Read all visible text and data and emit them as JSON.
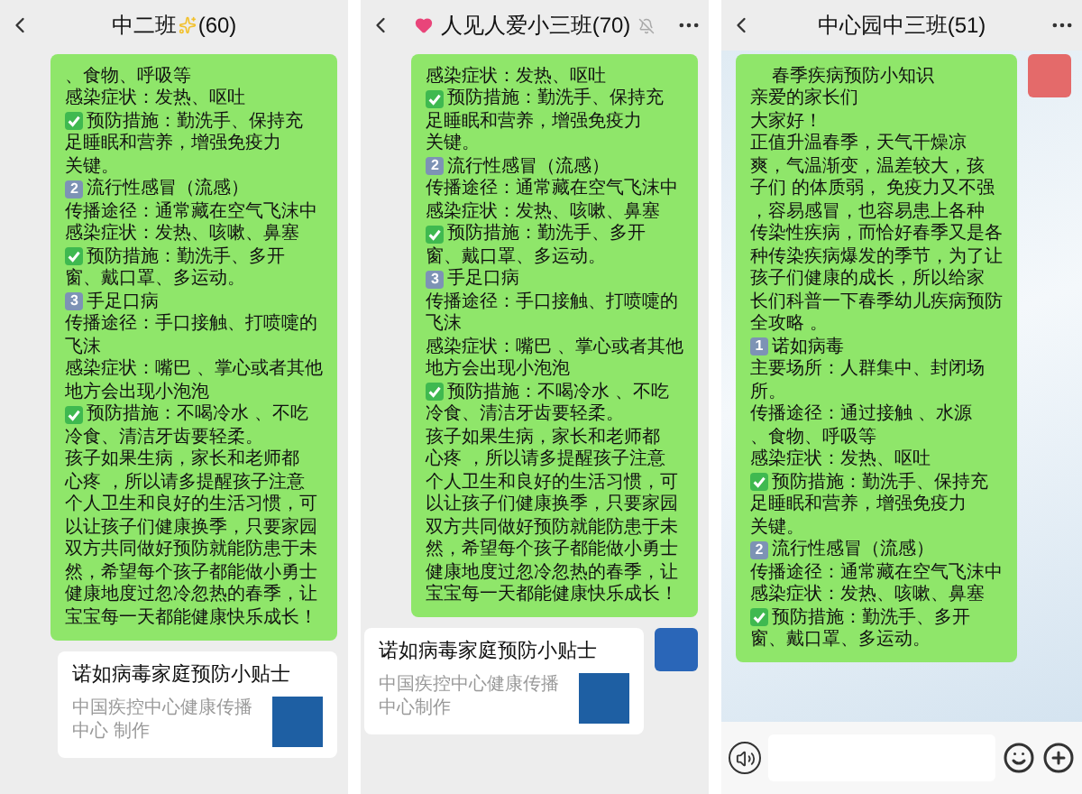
{
  "panels": [
    {
      "header": {
        "title": "中二班",
        "count": "(60)",
        "leading_icon": false,
        "trailing_icon": true,
        "muted": false,
        "menu": false
      },
      "input_bar": false,
      "messages": [
        {
          "kind": "bubble",
          "avatar": false,
          "lines": [
            {
              "kind": "text",
              "text": "、食物、呼吸等"
            },
            {
              "kind": "text",
              "text": "感染症状：发热、呕吐"
            },
            {
              "kind": "check",
              "text": "预防措施：勤洗手、保持充"
            },
            {
              "kind": "text",
              "text": "足睡眠和营养，增强免疫力"
            },
            {
              "kind": "text",
              "text": "关键。"
            },
            {
              "kind": "num",
              "badge": "2",
              "text": "流行性感冒（流感）"
            },
            {
              "kind": "text",
              "text": "传播途径：通常藏在空气飞沫中"
            },
            {
              "kind": "text",
              "text": "感染症状：发热、咳嗽、鼻塞"
            },
            {
              "kind": "check",
              "text": "预防措施：勤洗手、多开"
            },
            {
              "kind": "text",
              "text": "窗、戴口罩、多运动。"
            },
            {
              "kind": "num",
              "badge": "3",
              "text": "手足口病"
            },
            {
              "kind": "text",
              "text": "传播途径：手口接触、打喷嚏的"
            },
            {
              "kind": "text",
              "text": "飞沫"
            },
            {
              "kind": "text",
              "text": "感染症状：嘴巴 、掌心或者其他"
            },
            {
              "kind": "text",
              "text": "地方会出现小泡泡"
            },
            {
              "kind": "check",
              "text": "预防措施：不喝冷水 、不吃"
            },
            {
              "kind": "text",
              "text": "冷食、清洁牙齿要轻柔。"
            },
            {
              "kind": "text",
              "text": "孩子如果生病，家长和老师都"
            },
            {
              "kind": "text",
              "text": "心疼 ，所以请多提醒孩子注意"
            },
            {
              "kind": "text",
              "text": "个人卫生和良好的生活习惯，可"
            },
            {
              "kind": "text",
              "text": "以让孩子们健康换季，只要家园"
            },
            {
              "kind": "text",
              "text": "双方共同做好预防就能防患于未"
            },
            {
              "kind": "text",
              "text": "然，希望每个孩子都能做小勇士"
            },
            {
              "kind": "text",
              "text": "健康地度过忽冷忽热的春季，让"
            },
            {
              "kind": "text",
              "text": "宝宝每一天都能健康快乐成长！"
            }
          ]
        },
        {
          "kind": "card",
          "avatar": false,
          "title": "诺如病毒家庭预防小贴士",
          "source": "中国疾控中心健康传播中心 制作"
        }
      ]
    },
    {
      "header": {
        "title": "人见人爱小三班",
        "count": "(70)",
        "leading_icon": true,
        "trailing_icon": false,
        "muted": true,
        "menu": true
      },
      "input_bar": false,
      "messages": [
        {
          "kind": "bubble",
          "avatar": false,
          "lines": [
            {
              "kind": "text",
              "text": "感染症状：发热、呕吐"
            },
            {
              "kind": "check",
              "text": "预防措施：勤洗手、保持充"
            },
            {
              "kind": "text",
              "text": "足睡眠和营养，增强免疫力"
            },
            {
              "kind": "text",
              "text": "关键。"
            },
            {
              "kind": "num",
              "badge": "2",
              "text": "流行性感冒（流感）"
            },
            {
              "kind": "text",
              "text": "传播途径：通常藏在空气飞沫中"
            },
            {
              "kind": "text",
              "text": "感染症状：发热、咳嗽、鼻塞"
            },
            {
              "kind": "check",
              "text": "预防措施：勤洗手、多开"
            },
            {
              "kind": "text",
              "text": "窗、戴口罩、多运动。"
            },
            {
              "kind": "num",
              "badge": "3",
              "text": "手足口病"
            },
            {
              "kind": "text",
              "text": "传播途径：手口接触、打喷嚏的"
            },
            {
              "kind": "text",
              "text": "飞沫"
            },
            {
              "kind": "text",
              "text": "感染症状：嘴巴 、掌心或者其他"
            },
            {
              "kind": "text",
              "text": "地方会出现小泡泡"
            },
            {
              "kind": "check",
              "text": "预防措施：不喝冷水 、不吃"
            },
            {
              "kind": "text",
              "text": "冷食、清洁牙齿要轻柔。"
            },
            {
              "kind": "text",
              "text": "孩子如果生病，家长和老师都"
            },
            {
              "kind": "text",
              "text": "心疼 ，所以请多提醒孩子注意"
            },
            {
              "kind": "text",
              "text": "个人卫生和良好的生活习惯，可"
            },
            {
              "kind": "text",
              "text": "以让孩子们健康换季，只要家园"
            },
            {
              "kind": "text",
              "text": "双方共同做好预防就能防患于未"
            },
            {
              "kind": "text",
              "text": "然，希望每个孩子都能做小勇士"
            },
            {
              "kind": "text",
              "text": "健康地度过忽冷忽热的春季，让"
            },
            {
              "kind": "text",
              "text": "宝宝每一天都能健康快乐成长！"
            }
          ]
        },
        {
          "kind": "card",
          "avatar": true,
          "title": "诺如病毒家庭预防小贴士",
          "source": "中国疾控中心健康传播中心制作"
        }
      ]
    },
    {
      "header": {
        "title": "中心园中三班",
        "count": "(51)",
        "leading_icon": false,
        "trailing_icon": false,
        "muted": false,
        "menu": true
      },
      "input_bar": true,
      "messages": [
        {
          "kind": "bubble",
          "avatar": true,
          "lines": [
            {
              "kind": "heading",
              "text": "春季疾病预防小知识"
            },
            {
              "kind": "text",
              "text": "亲爱的家长们"
            },
            {
              "kind": "text",
              "text": "大家好！"
            },
            {
              "kind": "text",
              "text": "正值升温春季，天气干燥凉"
            },
            {
              "kind": "text",
              "text": "爽，气温渐变，温差较大，孩"
            },
            {
              "kind": "text",
              "text": "子们 的体质弱， 免疫力又不强"
            },
            {
              "kind": "text",
              "text": "，容易感冒，也容易患上各种"
            },
            {
              "kind": "text",
              "text": "传染性疾病，而恰好春季又是各"
            },
            {
              "kind": "text",
              "text": "种传染疾病爆发的季节，为了让"
            },
            {
              "kind": "text",
              "text": "孩子们健康的成长，所以给家"
            },
            {
              "kind": "text",
              "text": "长们科普一下春季幼儿疾病预防"
            },
            {
              "kind": "text",
              "text": "全攻略 。"
            },
            {
              "kind": "num",
              "badge": "1",
              "text": "诺如病毒"
            },
            {
              "kind": "text",
              "text": "主要场所：人群集中、封闭场"
            },
            {
              "kind": "text",
              "text": "所。"
            },
            {
              "kind": "text",
              "text": "传播途径：通过接触 、水源"
            },
            {
              "kind": "text",
              "text": "、食物、呼吸等"
            },
            {
              "kind": "text",
              "text": "感染症状：发热、呕吐"
            },
            {
              "kind": "check",
              "text": "预防措施：勤洗手、保持充"
            },
            {
              "kind": "text",
              "text": "足睡眠和营养，增强免疫力"
            },
            {
              "kind": "text",
              "text": "关键。"
            },
            {
              "kind": "num",
              "badge": "2",
              "text": "流行性感冒（流感）"
            },
            {
              "kind": "text",
              "text": "传播途径：通常藏在空气飞沫中"
            },
            {
              "kind": "text",
              "text": "感染症状：发热、咳嗽、鼻塞"
            },
            {
              "kind": "check",
              "text": "预防措施：勤洗手、多开"
            },
            {
              "kind": "text",
              "text": "窗、戴口罩、多运动。"
            }
          ]
        }
      ]
    }
  ]
}
